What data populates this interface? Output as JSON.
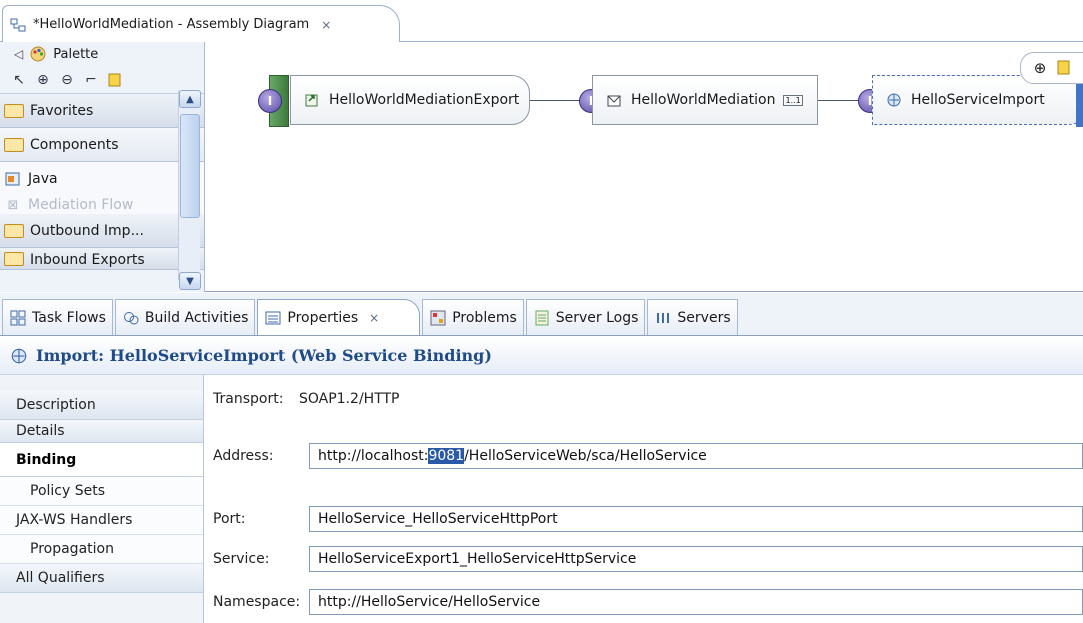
{
  "editor": {
    "tab_title": "*HelloWorldMediation - Assembly Diagram",
    "close_glyph": "×"
  },
  "palette": {
    "title": "Palette",
    "drawers": [
      {
        "label": "Favorites"
      },
      {
        "label": "Components"
      },
      {
        "label": "Outbound Imp..."
      },
      {
        "label": "Inbound Exports"
      }
    ],
    "entries": [
      {
        "label": "Java"
      },
      {
        "label": "Mediation Flow"
      }
    ]
  },
  "diagram": {
    "nodes": [
      {
        "label": "HelloWorldMediationExport",
        "icon": "export-icon"
      },
      {
        "label": "HelloWorldMediation",
        "icon": "mediation-icon",
        "tag": "1..1"
      },
      {
        "label": "HelloServiceImport",
        "icon": "import-icon"
      }
    ],
    "interface_glyph": "I"
  },
  "views": {
    "tabs": [
      {
        "label": "Task Flows",
        "icon": "task-flows-icon"
      },
      {
        "label": "Build Activities",
        "icon": "build-activities-icon"
      },
      {
        "label": "Properties",
        "icon": "properties-icon",
        "active": true
      },
      {
        "label": "Problems",
        "icon": "problems-icon"
      },
      {
        "label": "Server Logs",
        "icon": "server-logs-icon"
      },
      {
        "label": "Servers",
        "icon": "servers-icon"
      }
    ]
  },
  "properties": {
    "header_title": "Import: HelloServiceImport (Web Service Binding)",
    "sidebar": [
      {
        "label": "Description"
      },
      {
        "label": "Details"
      },
      {
        "label": "Binding",
        "selected": true
      },
      {
        "label": "Policy Sets"
      },
      {
        "label": "JAX-WS Handlers"
      },
      {
        "label": "Propagation"
      },
      {
        "label": "All Qualifiers"
      }
    ],
    "fields": {
      "transport_label": "Transport:",
      "transport_value": "SOAP1.2/HTTP",
      "address_label": "Address:",
      "address_prefix": "http://localhost:",
      "address_selected": "9081",
      "address_suffix": "/HelloServiceWeb/sca/HelloService",
      "port_label": "Port:",
      "port_value": "HelloService_HelloServiceHttpPort",
      "service_label": "Service:",
      "service_value": "HelloServiceExport1_HelloServiceHttpService",
      "namespace_label": "Namespace:",
      "namespace_value": "http://HelloService/HelloService"
    }
  },
  "colors": {
    "accent": "#1f4a8a",
    "selection": "#2a59a8",
    "interface": "#5c4da8"
  }
}
